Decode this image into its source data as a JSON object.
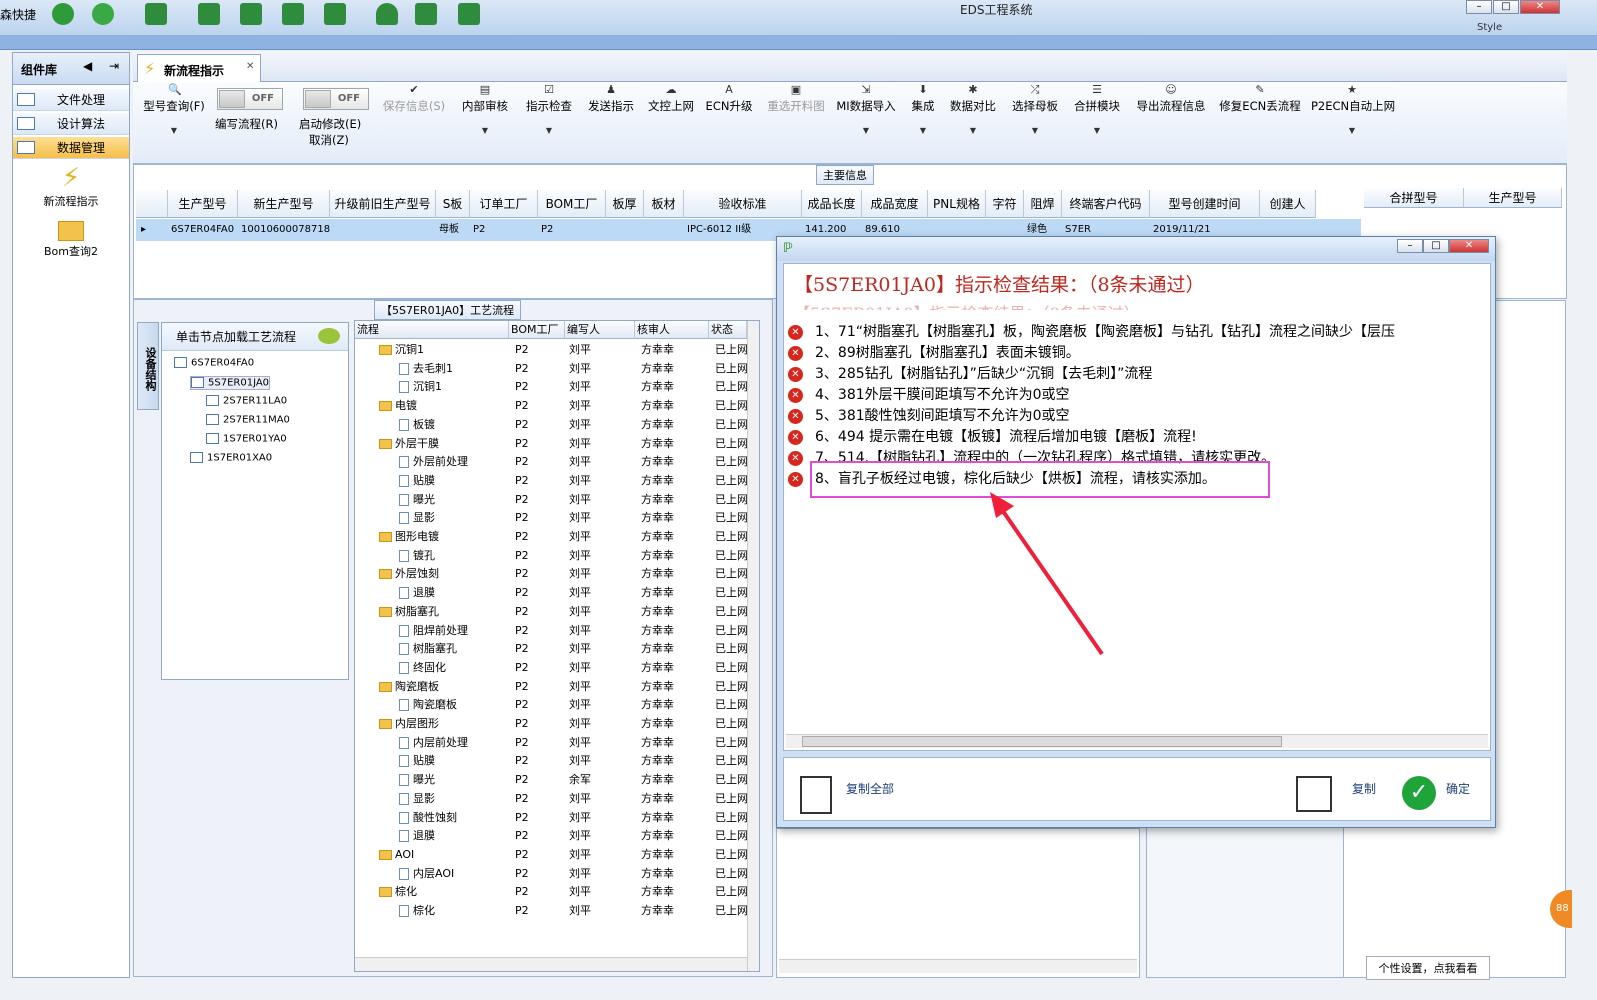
{
  "app": {
    "title": "EDS工程系统",
    "quick_label": "森快捷"
  },
  "window_controls": {
    "minimize": "–",
    "maximize": "□",
    "close": "✕"
  },
  "style_label": "Style",
  "left_panel": {
    "header": "组件库",
    "items": [
      {
        "label": "文件处理"
      },
      {
        "label": "设计算法"
      },
      {
        "label": "数据管理"
      }
    ],
    "tools": [
      {
        "label": "新流程指示"
      },
      {
        "label": "Bom查询2"
      }
    ]
  },
  "tab": {
    "label": "新流程指示",
    "close": "✕"
  },
  "ribbon": {
    "model_query": "型号查询(F)",
    "toggle_off": "OFF",
    "toggle1_label": "编写流程(R)",
    "toggle2_label": "启动修改(E)",
    "toggle2_sub": "取消(Z)",
    "buttons": [
      "保存信息(S)",
      "内部审核",
      "指示检查",
      "发送指示",
      "文控上网",
      "ECN升级",
      "重选开料图",
      "MI数据导入",
      "集成",
      "数据对比",
      "选择母板",
      "合拼模块",
      "导出流程信息",
      "修复ECN丢流程",
      "P2ECN自动上网"
    ]
  },
  "main_info": {
    "title": "主要信息",
    "headers": [
      "生产型号",
      "新生产型号",
      "升级前旧生产型号",
      "S板",
      "订单工厂",
      "BOM工厂",
      "板厚",
      "板材",
      "验收标准",
      "成品长度",
      "成品宽度",
      "PNL规格",
      "字符",
      "阻焊",
      "终端客户代码",
      "型号创建时间",
      "创建人"
    ],
    "row": {
      "model": "6S7ER04FA0",
      "new_model": "10010600078718",
      "s_board": "母板",
      "order_factory": "P2",
      "bom_factory": "P2",
      "standard": "IPC-6012 II级",
      "length": "141.200",
      "width": "89.610",
      "solder": "绿色",
      "customer": "S7ER",
      "created": "2019/11/21"
    },
    "right_headers": [
      "合拼型号",
      "生产型号"
    ]
  },
  "process": {
    "title": "【5S7ER01JA0】工艺流程",
    "tree_header": "单击节点加载工艺流程",
    "side_tab": "设备结构",
    "tree": [
      {
        "label": "6S7ER04FA0"
      },
      {
        "label": "5S7ER01JA0"
      },
      {
        "label": "2S7ER11LA0"
      },
      {
        "label": "2S7ER11MA0"
      },
      {
        "label": "1S7ER01YA0"
      },
      {
        "label": "1S7ER01XA0"
      }
    ],
    "grid_headers": [
      "流程",
      "BOM工厂",
      "编写人",
      "核审人",
      "状态"
    ],
    "rows": [
      {
        "name": "沉铜1",
        "type": "folder",
        "bom": "P2",
        "writer": "刘平",
        "reviewer": "方幸幸",
        "status": "已上网"
      },
      {
        "name": "去毛刺1",
        "type": "doc",
        "bom": "P2",
        "writer": "刘平",
        "reviewer": "方幸幸",
        "status": "已上网"
      },
      {
        "name": "沉铜1",
        "type": "doc",
        "bom": "P2",
        "writer": "刘平",
        "reviewer": "方幸幸",
        "status": "已上网"
      },
      {
        "name": "电镀",
        "type": "folder",
        "bom": "P2",
        "writer": "刘平",
        "reviewer": "方幸幸",
        "status": "已上网"
      },
      {
        "name": "板镀",
        "type": "doc",
        "bom": "P2",
        "writer": "刘平",
        "reviewer": "方幸幸",
        "status": "已上网"
      },
      {
        "name": "外层干膜",
        "type": "folder",
        "bom": "P2",
        "writer": "刘平",
        "reviewer": "方幸幸",
        "status": "已上网"
      },
      {
        "name": "外层前处理",
        "type": "doc",
        "bom": "P2",
        "writer": "刘平",
        "reviewer": "方幸幸",
        "status": "已上网"
      },
      {
        "name": "贴膜",
        "type": "doc",
        "bom": "P2",
        "writer": "刘平",
        "reviewer": "方幸幸",
        "status": "已上网"
      },
      {
        "name": "曝光",
        "type": "doc",
        "bom": "P2",
        "writer": "刘平",
        "reviewer": "方幸幸",
        "status": "已上网"
      },
      {
        "name": "显影",
        "type": "doc",
        "bom": "P2",
        "writer": "刘平",
        "reviewer": "方幸幸",
        "status": "已上网"
      },
      {
        "name": "图形电镀",
        "type": "folder",
        "bom": "P2",
        "writer": "刘平",
        "reviewer": "方幸幸",
        "status": "已上网"
      },
      {
        "name": "镀孔",
        "type": "doc",
        "bom": "P2",
        "writer": "刘平",
        "reviewer": "方幸幸",
        "status": "已上网"
      },
      {
        "name": "外层蚀刻",
        "type": "folder",
        "bom": "P2",
        "writer": "刘平",
        "reviewer": "方幸幸",
        "status": "已上网"
      },
      {
        "name": "退膜",
        "type": "doc",
        "bom": "P2",
        "writer": "刘平",
        "reviewer": "方幸幸",
        "status": "已上网"
      },
      {
        "name": "树脂塞孔",
        "type": "folder",
        "bom": "P2",
        "writer": "刘平",
        "reviewer": "方幸幸",
        "status": "已上网"
      },
      {
        "name": "阻焊前处理",
        "type": "doc",
        "bom": "P2",
        "writer": "刘平",
        "reviewer": "方幸幸",
        "status": "已上网"
      },
      {
        "name": "树脂塞孔",
        "type": "doc",
        "bom": "P2",
        "writer": "刘平",
        "reviewer": "方幸幸",
        "status": "已上网"
      },
      {
        "name": "终固化",
        "type": "doc",
        "bom": "P2",
        "writer": "刘平",
        "reviewer": "方幸幸",
        "status": "已上网"
      },
      {
        "name": "陶瓷磨板",
        "type": "folder",
        "bom": "P2",
        "writer": "刘平",
        "reviewer": "方幸幸",
        "status": "已上网"
      },
      {
        "name": "陶瓷磨板",
        "type": "doc",
        "bom": "P2",
        "writer": "刘平",
        "reviewer": "方幸幸",
        "status": "已上网"
      },
      {
        "name": "内层图形",
        "type": "folder",
        "bom": "P2",
        "writer": "刘平",
        "reviewer": "方幸幸",
        "status": "已上网"
      },
      {
        "name": "内层前处理",
        "type": "doc",
        "bom": "P2",
        "writer": "刘平",
        "reviewer": "方幸幸",
        "status": "已上网"
      },
      {
        "name": "贴膜",
        "type": "doc",
        "bom": "P2",
        "writer": "刘平",
        "reviewer": "方幸幸",
        "status": "已上网"
      },
      {
        "name": "曝光",
        "type": "doc",
        "bom": "P2",
        "writer": "余军",
        "reviewer": "方幸幸",
        "status": "已上网"
      },
      {
        "name": "显影",
        "type": "doc",
        "bom": "P2",
        "writer": "刘平",
        "reviewer": "方幸幸",
        "status": "已上网"
      },
      {
        "name": "酸性蚀刻",
        "type": "doc",
        "bom": "P2",
        "writer": "刘平",
        "reviewer": "方幸幸",
        "status": "已上网"
      },
      {
        "name": "退膜",
        "type": "doc",
        "bom": "P2",
        "writer": "刘平",
        "reviewer": "方幸幸",
        "status": "已上网"
      },
      {
        "name": "AOI",
        "type": "folder",
        "bom": "P2",
        "writer": "刘平",
        "reviewer": "方幸幸",
        "status": "已上网"
      },
      {
        "name": "内层AOI",
        "type": "doc",
        "bom": "P2",
        "writer": "刘平",
        "reviewer": "方幸幸",
        "status": "已上网"
      },
      {
        "name": "棕化",
        "type": "folder",
        "bom": "P2",
        "writer": "刘平",
        "reviewer": "方幸幸",
        "status": "已上网"
      },
      {
        "name": "棕化",
        "type": "doc",
        "bom": "P2",
        "writer": "刘平",
        "reviewer": "方幸幸",
        "status": "已上网"
      }
    ]
  },
  "dialog": {
    "heading": "【5S7ER01JA0】指示检查结果：（8条未通过）",
    "ghost_heading": "【5S7ER01JA0】指示检查结果：（8条未通过）",
    "errors": [
      "1、71“树脂塞孔【树脂塞孔】板，陶瓷磨板【陶瓷磨板】与钻孔【钻孔】流程之间缺少【层压",
      "2、89树脂塞孔【树脂塞孔】表面未镀铜。",
      "3、285钻孔【树脂钻孔】”后缺少“沉铜【去毛刺】”流程",
      "4、381外层干膜间距填写不允许为0或空",
      "5、381酸性蚀刻间距填写不允许为0或空",
      "6、494 提示需在电镀【板镀】流程后增加电镀【磨板】流程!",
      "7、514.【树脂钻孔】流程中的（一次钻孔程序）格式填错，请核实更改。",
      "8、盲孔子板经过电镀，棕化后缺少【烘板】流程，请核实添加。"
    ],
    "copy_all": "复制全部",
    "copy": "复制",
    "ok": "确定"
  },
  "bottom_hint": "个性设置，点我看看",
  "badge_text": "88"
}
